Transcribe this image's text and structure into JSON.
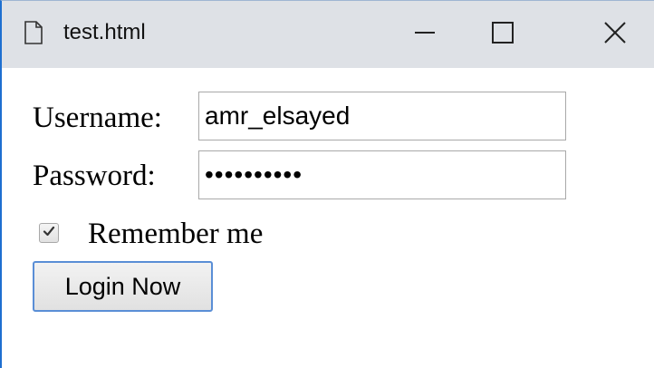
{
  "window": {
    "title": "test.html",
    "accent_color": "#1e6fd0",
    "titlebar_color": "#dee1e6",
    "icons": {
      "document": "document-icon",
      "minimize": "minimize-icon",
      "maximize": "maximize-icon",
      "close": "close-icon"
    }
  },
  "form": {
    "username_label": "Username:",
    "username_value": "amr_elsayed",
    "password_label": "Password:",
    "password_value": "••••••••••",
    "remember_label": "Remember me",
    "remember_checked": true,
    "login_button_label": "Login Now"
  }
}
